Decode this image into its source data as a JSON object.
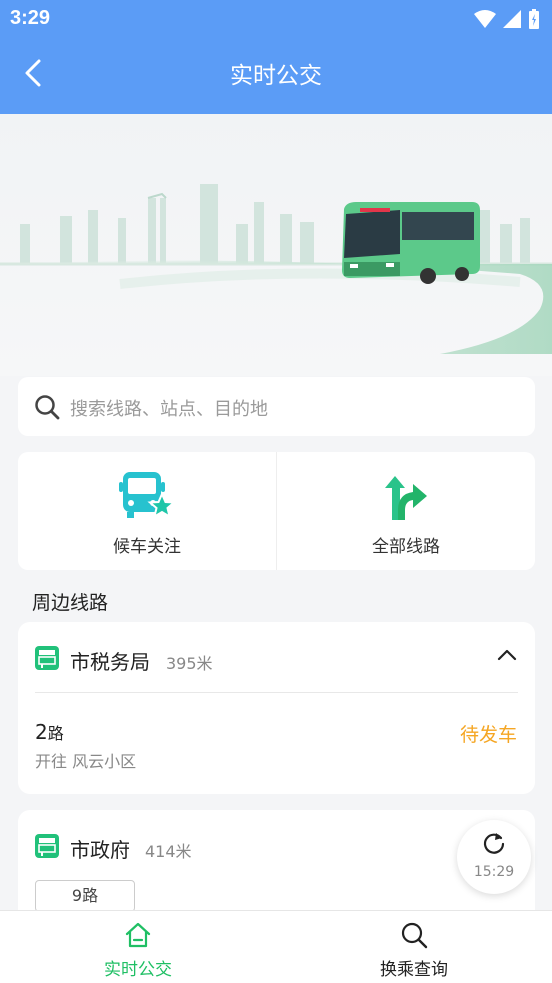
{
  "status_bar": {
    "time": "3:29"
  },
  "header": {
    "title": "实时公交"
  },
  "search": {
    "placeholder": "搜索线路、站点、目的地"
  },
  "quick_actions": [
    {
      "label": "候车关注",
      "icon": "bus-star-icon"
    },
    {
      "label": "全部线路",
      "icon": "route-split-icon"
    }
  ],
  "section": {
    "title": "周边线路"
  },
  "stops": [
    {
      "name": "市税务局",
      "distance": "395米",
      "routes": [
        {
          "number": "2",
          "suffix": "路",
          "direction": "开往 风云小区",
          "status": "待发车"
        }
      ]
    },
    {
      "name": "市政府",
      "distance": "414米",
      "routes": [
        {
          "label": "9路"
        }
      ]
    }
  ],
  "refresh": {
    "time": "15:29"
  },
  "tabs": [
    {
      "label": "实时公交",
      "active": true
    },
    {
      "label": "换乘查询",
      "active": false
    }
  ],
  "colors": {
    "primary": "#5b9cf6",
    "accent_green": "#1fbf64",
    "status_orange": "#f5a623"
  }
}
